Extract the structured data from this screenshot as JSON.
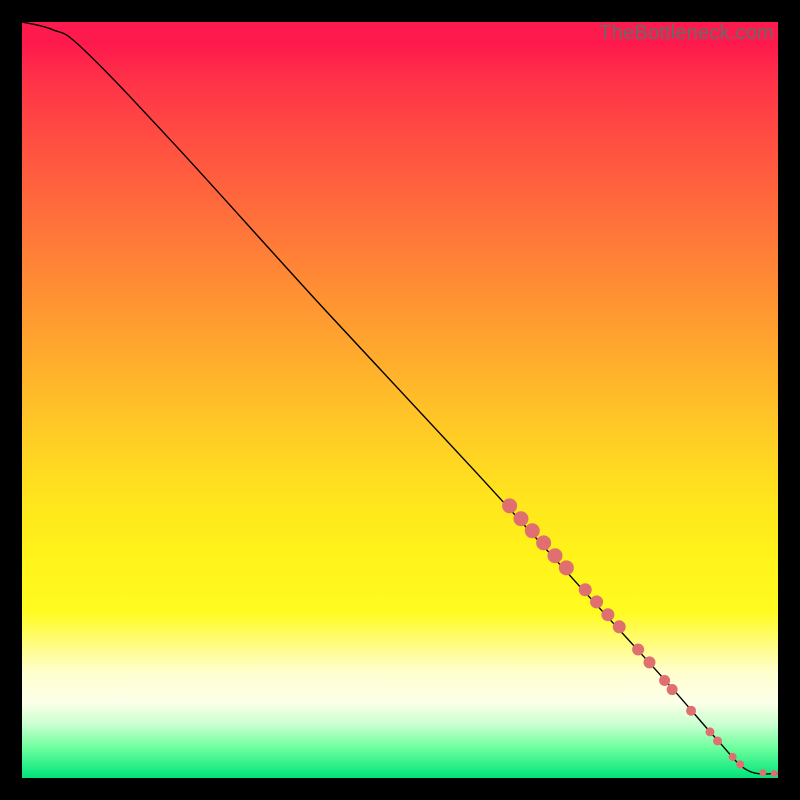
{
  "watermark": "TheBottleneck.com",
  "colors": {
    "marker": "#e07070",
    "curve": "#000000",
    "backgroundTop": "#ff1a4d",
    "backgroundBottom": "#00e37a",
    "pageBg": "#000000"
  },
  "chart_data": {
    "type": "line",
    "title": "",
    "xlabel": "",
    "ylabel": "",
    "xlim": [
      0,
      100
    ],
    "ylim": [
      0,
      100
    ],
    "curve": {
      "x": [
        0,
        4,
        8,
        20,
        40,
        60,
        75,
        85,
        92,
        96,
        100
      ],
      "y": [
        100,
        99,
        96.5,
        84,
        62,
        40.5,
        24,
        13,
        5,
        1,
        0.6
      ]
    },
    "markers": [
      {
        "x": 64.5,
        "y": 36.0,
        "r": 7.5
      },
      {
        "x": 66.0,
        "y": 34.3,
        "r": 7.5
      },
      {
        "x": 67.5,
        "y": 32.7,
        "r": 7.5
      },
      {
        "x": 69.0,
        "y": 31.1,
        "r": 7.5
      },
      {
        "x": 70.5,
        "y": 29.4,
        "r": 7.5
      },
      {
        "x": 72.0,
        "y": 27.8,
        "r": 7.5
      },
      {
        "x": 74.5,
        "y": 24.9,
        "r": 6.5
      },
      {
        "x": 76.0,
        "y": 23.3,
        "r": 6.5
      },
      {
        "x": 77.5,
        "y": 21.6,
        "r": 6.5
      },
      {
        "x": 79.0,
        "y": 20.0,
        "r": 6.5
      },
      {
        "x": 81.5,
        "y": 17.0,
        "r": 6.0
      },
      {
        "x": 83.0,
        "y": 15.3,
        "r": 6.0
      },
      {
        "x": 85.0,
        "y": 12.9,
        "r": 5.5
      },
      {
        "x": 86.0,
        "y": 11.7,
        "r": 5.5
      },
      {
        "x": 88.5,
        "y": 8.9,
        "r": 5.0
      },
      {
        "x": 91.0,
        "y": 6.1,
        "r": 4.5
      },
      {
        "x": 92.0,
        "y": 4.9,
        "r": 4.5
      },
      {
        "x": 94.0,
        "y": 2.8,
        "r": 4.0
      },
      {
        "x": 95.0,
        "y": 1.8,
        "r": 4.0
      },
      {
        "x": 98.0,
        "y": 0.7,
        "r": 3.5
      },
      {
        "x": 99.5,
        "y": 0.6,
        "r": 3.5
      }
    ]
  }
}
